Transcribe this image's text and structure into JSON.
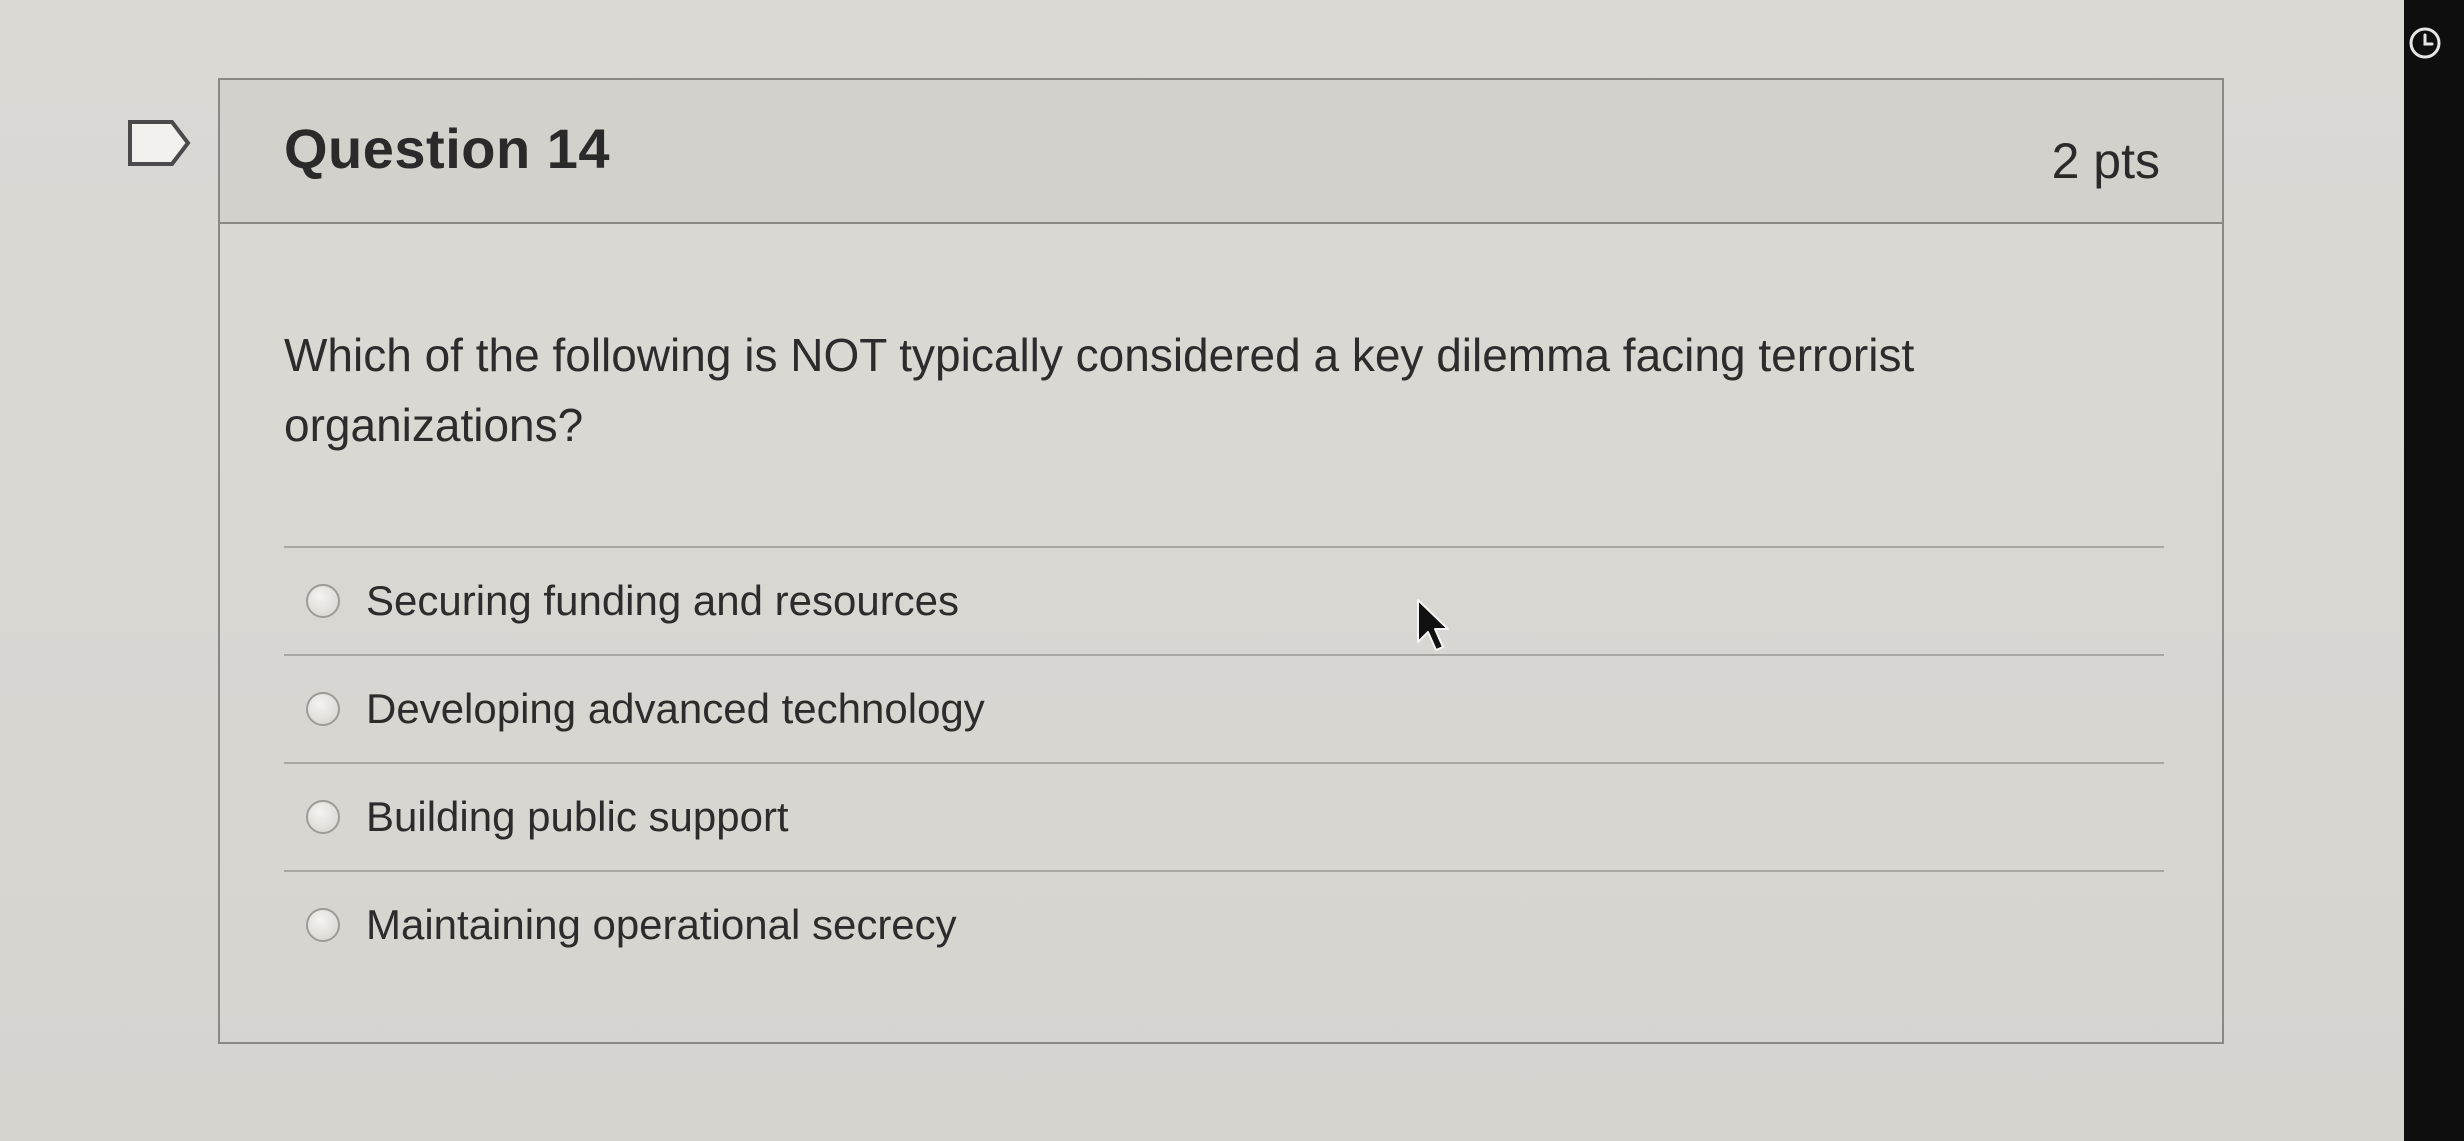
{
  "question": {
    "title": "Question 14",
    "points": "2 pts",
    "text": "Which of the following is NOT typically considered a key dilemma facing terrorist organizations?",
    "answers": [
      {
        "label": "Securing funding and resources"
      },
      {
        "label": "Developing advanced technology"
      },
      {
        "label": "Building public support"
      },
      {
        "label": "Maintaining operational secrecy"
      }
    ]
  },
  "icons": {
    "flag": "flag-question-icon",
    "clock": "timer-icon",
    "cursor": "mouse-pointer-icon"
  }
}
